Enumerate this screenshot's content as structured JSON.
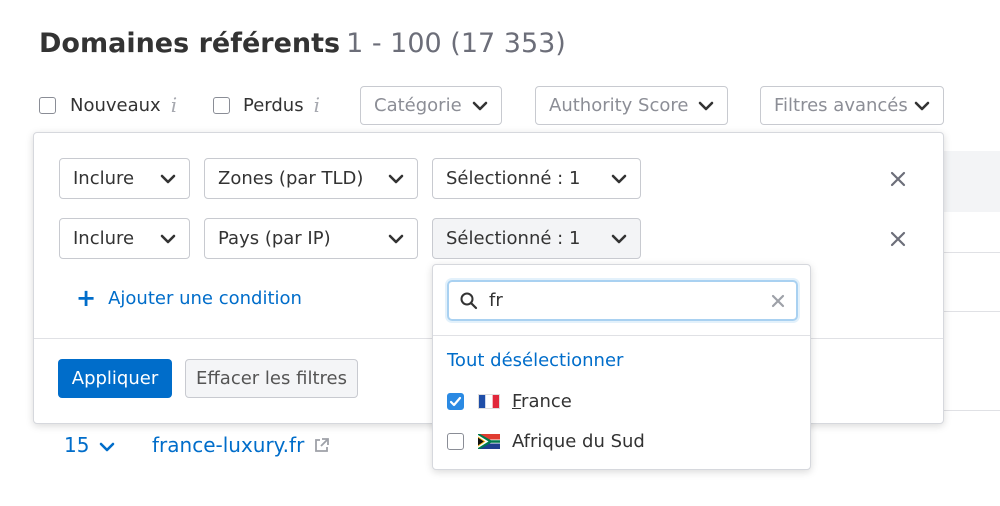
{
  "header": {
    "title": "Domaines référents",
    "range": "1 - 100 (17 353)"
  },
  "toolbar": {
    "new_label": "Nouveaux",
    "lost_label": "Perdus",
    "info_glyph": "i",
    "category_placeholder": "Catégorie",
    "authority_placeholder": "Authority Score",
    "advanced_filters_label": "Filtres avancés"
  },
  "filter_panel": {
    "conditions": [
      {
        "mode": "Inclure",
        "field": "Zones (par TLD)",
        "value": "Sélectionné : 1"
      },
      {
        "mode": "Inclure",
        "field": "Pays (par IP)",
        "value": "Sélectionné : 1"
      }
    ],
    "add_condition_label": "Ajouter une condition",
    "apply_label": "Appliquer",
    "clear_label": "Effacer les filtres"
  },
  "country_dropdown": {
    "search_value": "fr",
    "deselect_all_label": "Tout désélectionner",
    "options": [
      {
        "label": "France",
        "checked": true,
        "flag": "flag-france"
      },
      {
        "label": "Afrique du Sud",
        "checked": false,
        "flag": "flag-south-africa"
      }
    ]
  },
  "table_row": {
    "count": "15",
    "domain": "france-luxury.fr"
  },
  "colors": {
    "accent": "#006dca",
    "checkbox_checked": "#2b8ae3",
    "focus_ring": "#a9d1f1"
  }
}
